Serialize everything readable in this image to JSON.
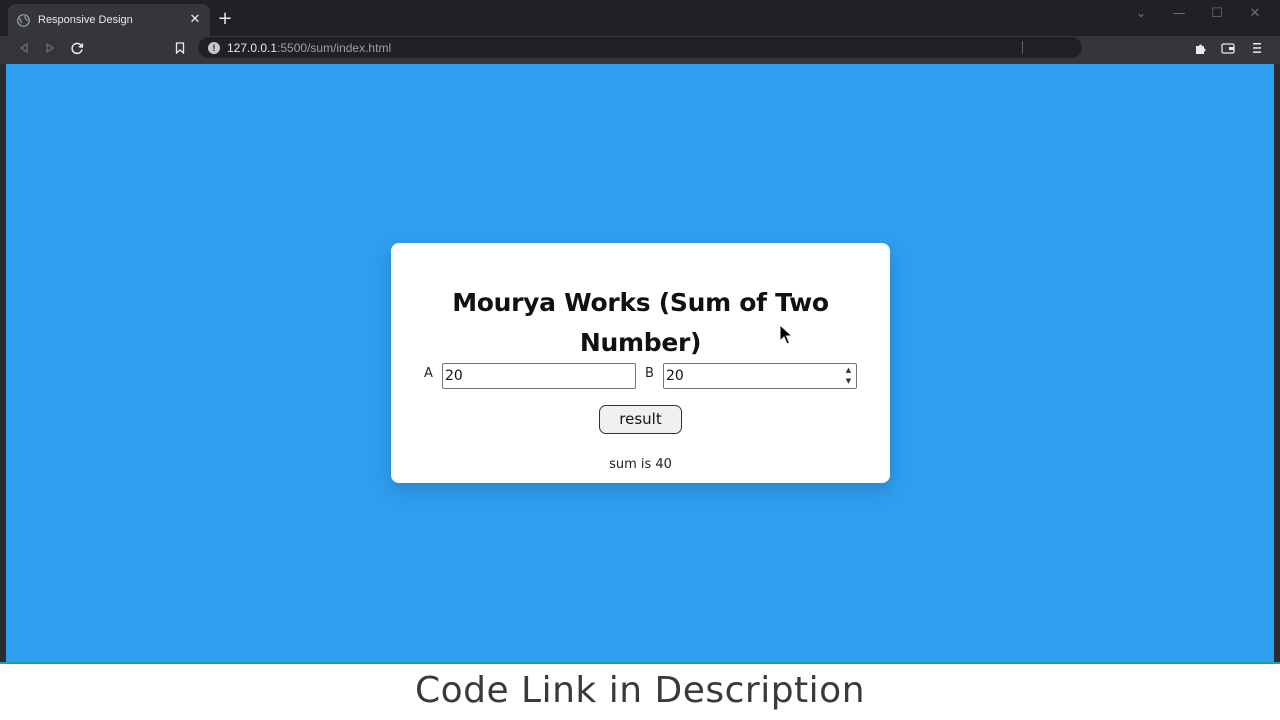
{
  "browser": {
    "tab_title": "Responsive Design",
    "url_host": "127.0.0.1",
    "url_path": ":5500/sum/index.html",
    "accent": "#2f9ef0"
  },
  "page": {
    "heading": "Mourya Works (Sum of Two Number)",
    "label_a": "A",
    "label_b": "B",
    "value_a": "20",
    "value_b": "20",
    "button_label": "result",
    "sum_text": "sum is 40",
    "background_color": "#2f9ef0"
  },
  "overlay": {
    "caption": "Code Link in Description"
  }
}
